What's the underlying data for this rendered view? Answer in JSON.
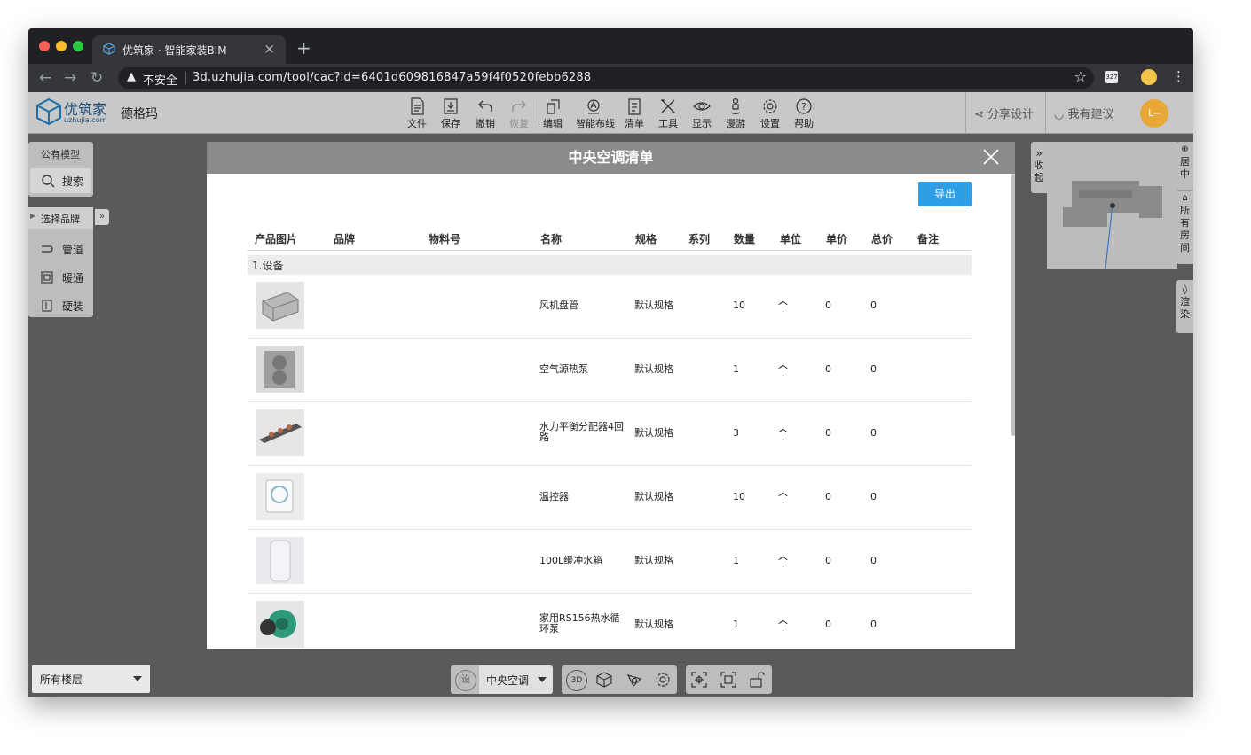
{
  "browser": {
    "tab_title": "优筑家 · 智能家装BIM",
    "tab_close": "×",
    "new_tab": "+",
    "insecure_label": "不安全",
    "url": "3d.uzhujia.com/tool/cac?id=6401d609816847a59f4f0520febb6288",
    "ext_badge": "327"
  },
  "app": {
    "logo_text": "优筑家",
    "logo_sub": "uzhujia.com",
    "brand_name": "德格玛",
    "toolbar": [
      {
        "label": "文件",
        "icon": "file-icon"
      },
      {
        "label": "保存",
        "icon": "save-icon"
      },
      {
        "label": "撤销",
        "icon": "undo-icon"
      },
      {
        "label": "恢复",
        "icon": "redo-icon"
      },
      {
        "label": "编辑",
        "icon": "edit-icon"
      },
      {
        "label": "智能布线",
        "icon": "smart-wiring-icon"
      },
      {
        "label": "清单",
        "icon": "list-icon"
      },
      {
        "label": "工具",
        "icon": "tools-icon"
      },
      {
        "label": "显示",
        "icon": "eye-icon"
      },
      {
        "label": "漫游",
        "icon": "walk-icon"
      },
      {
        "label": "设置",
        "icon": "gear-icon"
      },
      {
        "label": "帮助",
        "icon": "help-icon"
      }
    ],
    "share_label": "分享设计",
    "suggest_label": "我有建议",
    "avatar_text": "L--"
  },
  "left_panel": {
    "public_models": "公有模型",
    "search": "搜索",
    "select_brand": "选择品牌",
    "items": [
      "管道",
      "暖通",
      "硬装"
    ]
  },
  "right_panel": {
    "collapse": [
      "收",
      "起"
    ],
    "center": [
      "居",
      "中"
    ],
    "all_rooms": [
      "所",
      "有",
      "房",
      "间"
    ],
    "render": [
      "渲",
      "染"
    ]
  },
  "modal": {
    "title": "中央空调清单",
    "export_label": "导出",
    "columns": [
      "产品图片",
      "品牌",
      "物料号",
      "名称",
      "规格",
      "系列",
      "数量",
      "单位",
      "单价",
      "总价",
      "备注"
    ],
    "group_label": "1.设备",
    "rows": [
      {
        "name": "风机盘管",
        "spec": "默认规格",
        "qty": "10",
        "unit": "个",
        "price": "0",
        "total": "0"
      },
      {
        "name": "空气源热泵",
        "spec": "默认规格",
        "qty": "1",
        "unit": "个",
        "price": "0",
        "total": "0"
      },
      {
        "name": "水力平衡分配器4回路",
        "spec": "默认规格",
        "qty": "3",
        "unit": "个",
        "price": "0",
        "total": "0"
      },
      {
        "name": "温控器",
        "spec": "默认规格",
        "qty": "10",
        "unit": "个",
        "price": "0",
        "total": "0"
      },
      {
        "name": "100L缓冲水箱",
        "spec": "默认规格",
        "qty": "1",
        "unit": "个",
        "price": "0",
        "total": "0"
      },
      {
        "name": "家用RS156热水循环泵",
        "spec": "默认规格",
        "qty": "1",
        "unit": "个",
        "price": "0",
        "total": "0"
      }
    ]
  },
  "bottom": {
    "floor_select": "所有楼层",
    "set_badge": "设",
    "system_select": "中央空调",
    "view3d": "3D"
  },
  "colors": {
    "accent": "#2e9ee6",
    "modal_header": "#8b8b8b",
    "workspace": "#5a5a5a"
  }
}
